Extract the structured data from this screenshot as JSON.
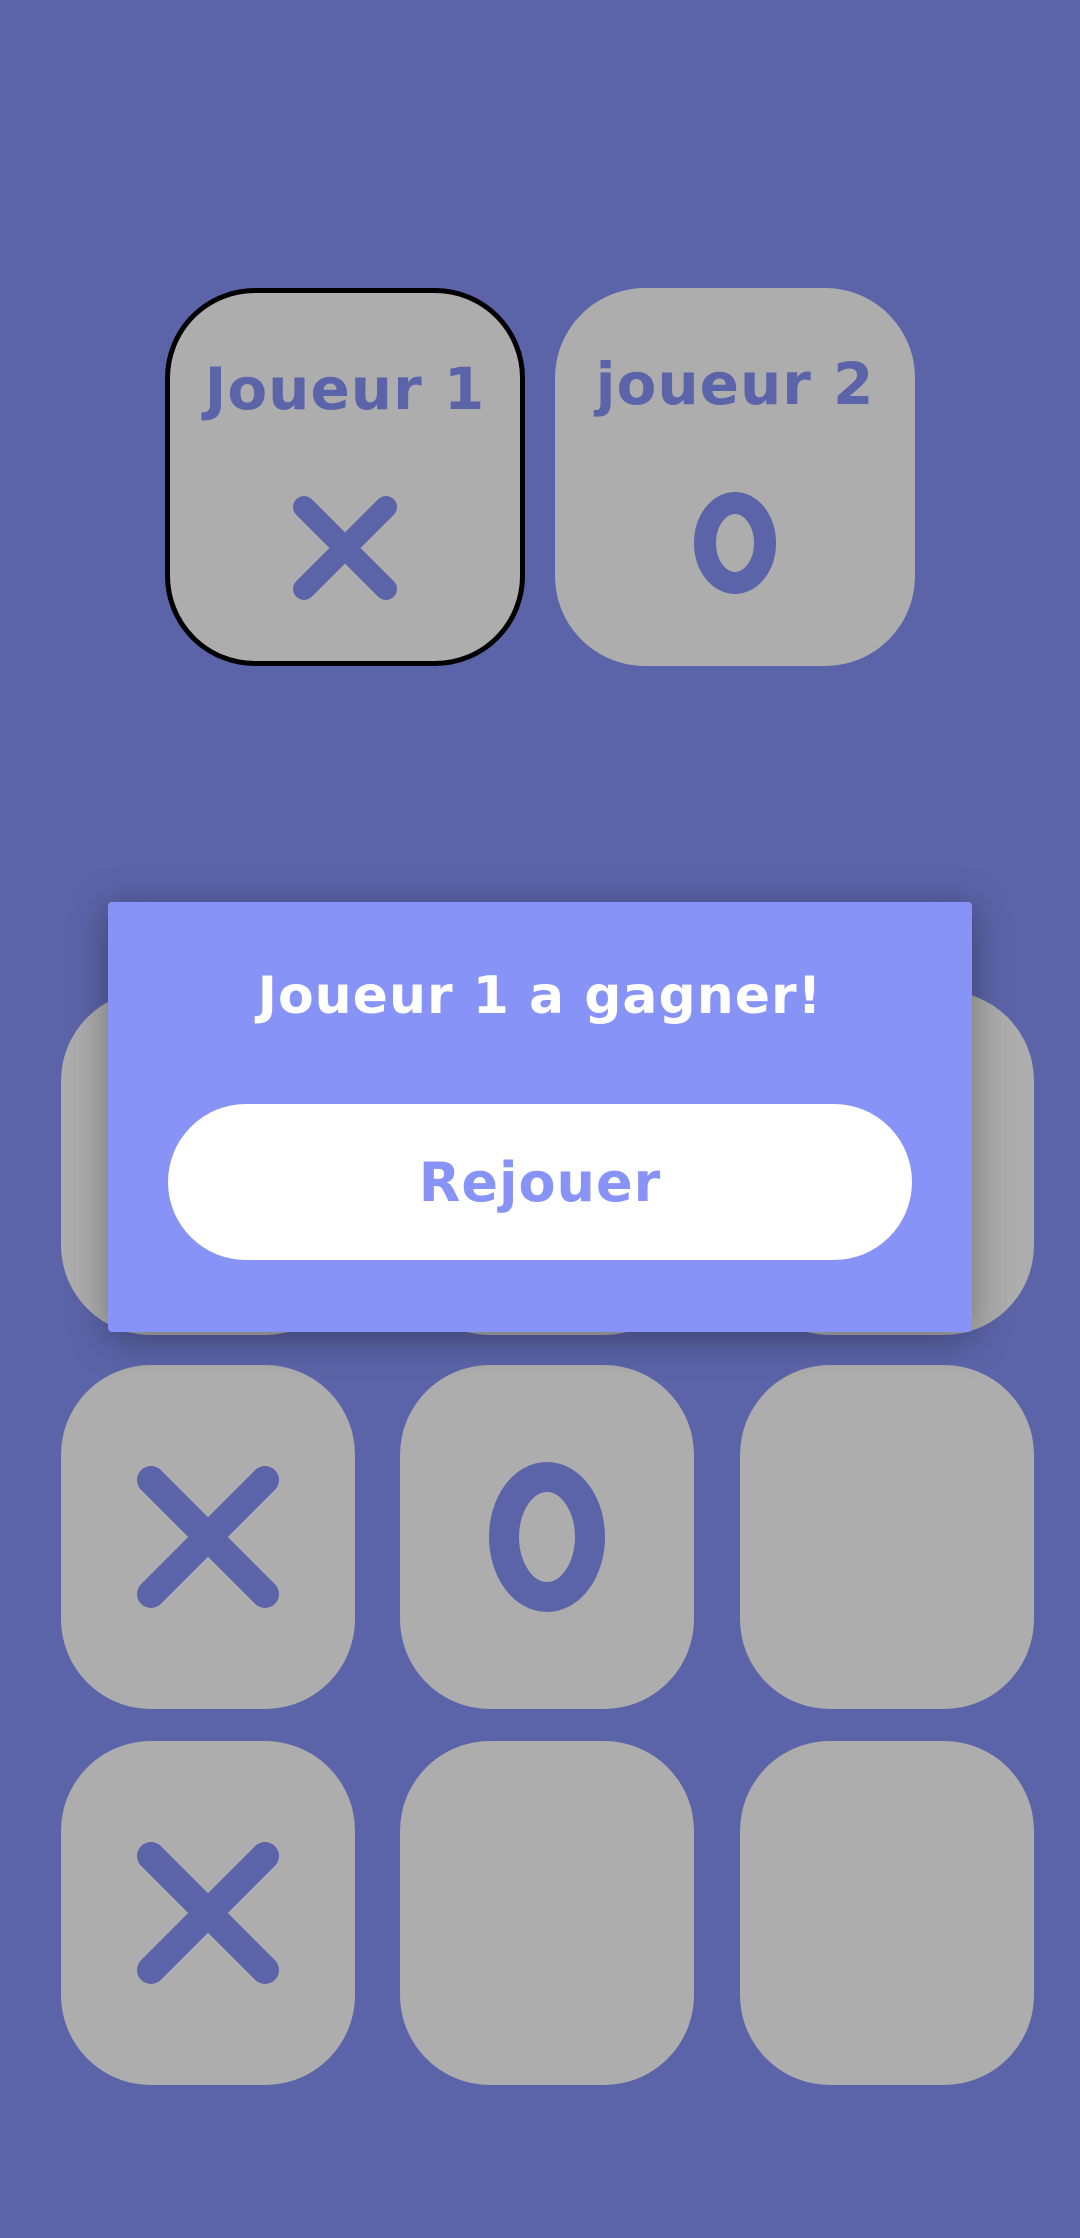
{
  "colors": {
    "background": "#5b64a8",
    "card": "#adadad",
    "mark": "#5b64a8",
    "modal": "#8893f7",
    "button": "#ffffff",
    "active_border": "#000000"
  },
  "players": [
    {
      "name": "Joueur 1",
      "mark": "X",
      "mark_icon": "x-icon",
      "active": true
    },
    {
      "name": "joueur 2",
      "mark": "O",
      "mark_icon": "o-icon",
      "active": false
    }
  ],
  "board": {
    "cells": [
      [
        "",
        "",
        ""
      ],
      [
        "X",
        "O",
        ""
      ],
      [
        "X",
        "",
        ""
      ]
    ]
  },
  "result_dialog": {
    "message": "Joueur 1 a gagner!",
    "replay_label": "Rejouer"
  }
}
